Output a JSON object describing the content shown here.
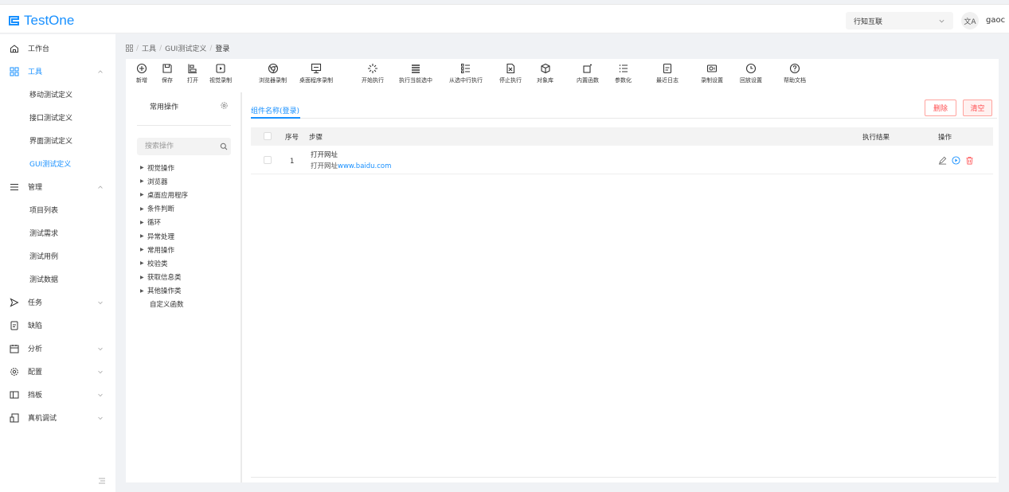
{
  "app": {
    "logo_text": "TestOne",
    "brand_color": "#1890ff"
  },
  "header": {
    "org_name": "行知互联",
    "translate_label": "文A",
    "user_name": "gaoc"
  },
  "sidebar": {
    "items": [
      {
        "label": "工作台",
        "icon": "home-icon"
      },
      {
        "label": "工具",
        "icon": "grid-icon",
        "expanded": true,
        "active": true
      },
      {
        "label": "移动测试定义",
        "sub": true
      },
      {
        "label": "接口测试定义",
        "sub": true
      },
      {
        "label": "界面测试定义",
        "sub": true
      },
      {
        "label": "GUI测试定义",
        "sub": true,
        "active": true
      },
      {
        "label": "管理",
        "icon": "list-icon",
        "expanded": true
      },
      {
        "label": "项目列表",
        "sub": true
      },
      {
        "label": "测试需求",
        "sub": true
      },
      {
        "label": "测试用例",
        "sub": true
      },
      {
        "label": "测试数据",
        "sub": true
      },
      {
        "label": "任务",
        "icon": "send-icon"
      },
      {
        "label": "缺陷",
        "icon": "document-icon"
      },
      {
        "label": "分析",
        "icon": "calendar-icon"
      },
      {
        "label": "配置",
        "icon": "gear-icon"
      },
      {
        "label": "挡板",
        "icon": "panel-icon"
      },
      {
        "label": "真机调试",
        "icon": "device-icon"
      }
    ]
  },
  "breadcrumb": {
    "home_icon": "grid-icon",
    "items": [
      "工具",
      "GUI测试定义",
      "登录"
    ]
  },
  "toolbar": {
    "new": "新增",
    "save": "保存",
    "open": "打开",
    "visual_record": "视觉录制",
    "browser_record": "浏览器录制",
    "desktop_record": "桌面程序录制",
    "start": "开始执行",
    "run_selected_current": "执行当前选中",
    "run_from_selected": "从选中行执行",
    "stop": "停止执行",
    "object_lib": "对象库",
    "builtin_func": "内置函数",
    "parameterize": "参数化",
    "recent_log": "最近日志",
    "record_settings": "录制设置",
    "playback_settings": "回放设置",
    "help_doc": "帮助文档"
  },
  "left_panel": {
    "title": "常用操作",
    "search_placeholder": "搜索操作",
    "tree": [
      "视觉操作",
      "浏览器",
      "桌面应用程序",
      "条件判断",
      "循环",
      "异常处理",
      "常用操作",
      "校验类",
      "获取信息类",
      "其他操作类"
    ],
    "custom_func": "自定义函数"
  },
  "component": {
    "tab_label": "组件名称(登录)",
    "delete_label": "删除",
    "clear_label": "清空"
  },
  "table": {
    "headers": {
      "index": "序号",
      "step": "步骤",
      "result": "执行结果",
      "ops": "操作"
    },
    "rows": [
      {
        "index": "1",
        "name": "打开网址",
        "desc_prefix": "打开网址",
        "desc_url": "www.baidu.com",
        "result": ""
      }
    ]
  },
  "colors": {
    "danger": "#ff4d4f",
    "accent": "#1890ff"
  }
}
